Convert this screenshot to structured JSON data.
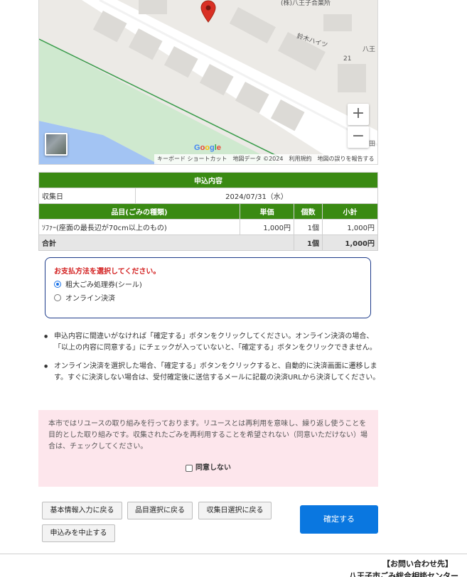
{
  "map": {
    "labels": {
      "top_right": "(株)八王子合菓所",
      "heights": "鈴木ハイツ",
      "hachi": "八王",
      "number": "21",
      "right_side": "都田"
    },
    "zoom_in": "+",
    "zoom_out": "−",
    "google_letters": [
      "G",
      "o",
      "o",
      "g",
      "l",
      "e"
    ],
    "attribution": {
      "shortcuts": "キーボード ショートカット",
      "data": "地図データ ©2024",
      "terms": "利用規約",
      "report": "地図の誤りを報告する"
    },
    "pin_color": "#d93025"
  },
  "order": {
    "section_title": "申込内容",
    "collection_label": "収集日",
    "collection_date": "2024/07/31（水）",
    "columns": [
      "品目(ごみの種類)",
      "単価",
      "個数",
      "小計"
    ],
    "rows": [
      {
        "item": "ｿﾌｧｰ(座面の最長辺が70cm以上のもの)",
        "price": "1,000円",
        "qty": "1個",
        "subtotal": "1,000円"
      }
    ],
    "total_label": "合計",
    "total_qty": "1個",
    "total_amount": "1,000円",
    "header_color": "#3a8a13"
  },
  "payment": {
    "title": "お支払方法を選択してください。",
    "options": [
      {
        "label": "粗大ごみ処理券(シール)",
        "selected": true
      },
      {
        "label": "オンライン決済",
        "selected": false
      }
    ]
  },
  "notes": [
    "申込内容に間違いがなければ「確定する」ボタンをクリックしてください。オンライン決済の場合、「以上の内容に同意する」にチェックが入っていないと、「確定する」ボタンをクリックできません。",
    "オンライン決済を選択した場合、「確定する」ボタンをクリックすると、自動的に決済画面に遷移します。すぐに決済しない場合は、受付確定後に送信するメールに記載の決済URLから決済してください。"
  ],
  "reuse": {
    "text": "本市ではリユースの取り組みを行っております。リユースとは再利用を意味し、繰り返し使うことを目的とした取り組みです。収集されたごみを再利用することを希望されない（同意いただけない）場合は、チェックしてください。",
    "checkbox_label": "同意しない"
  },
  "buttons": {
    "back_basic": "基本情報入力に戻る",
    "back_item": "品目選択に戻る",
    "back_date": "収集日選択に戻る",
    "cancel": "申込みを中止する",
    "confirm": "確定する"
  },
  "contact": {
    "heading": "【お問い合わせ先】",
    "sub": "八王子市ごみ総合相談センター"
  }
}
